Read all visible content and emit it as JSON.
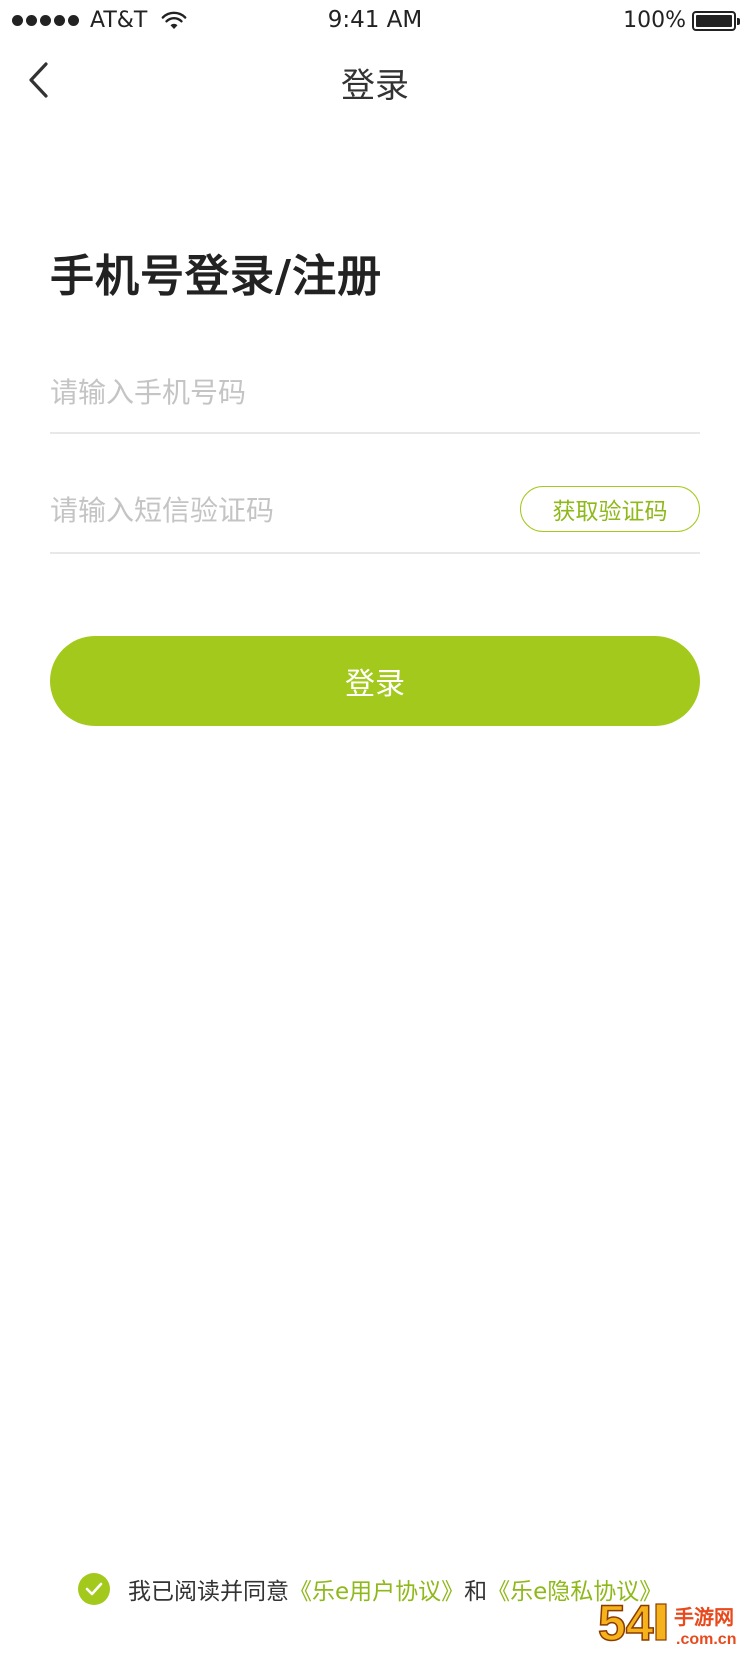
{
  "status_bar": {
    "carrier": "AT&T",
    "time": "9:41 AM",
    "battery": "100%",
    "icons": [
      "signal-dots-icon",
      "wifi-icon",
      "battery-icon"
    ]
  },
  "nav": {
    "title": "登录",
    "back_icon": "chevron-left-icon"
  },
  "form": {
    "heading": "手机号登录/注册",
    "phone_placeholder": "请输入手机号码",
    "phone_value": "",
    "code_placeholder": "请输入短信验证码",
    "code_value": "",
    "get_code_label": "获取验证码",
    "login_label": "登录"
  },
  "agreement": {
    "checked": true,
    "prefix": "我已阅读并同意",
    "user_agreement": "《乐e用户协议》",
    "and": "和",
    "privacy_agreement": "《乐e隐私协议》"
  },
  "watermark": {
    "brand_main": "54",
    "brand_extra": "手游网",
    "brand_domain": ".com.cn"
  },
  "colors": {
    "accent": "#a3c91c",
    "accent_text": "#8fb81a",
    "placeholder": "#c4c4c4",
    "divider": "#e8e8e8"
  }
}
